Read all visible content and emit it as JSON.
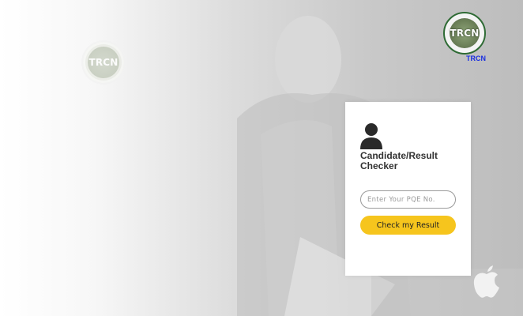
{
  "header": {
    "brand_text": "TRCN",
    "logo_text": "TRCN",
    "watermark_logo_text": "TRCN"
  },
  "login_card": {
    "title": "Candidate/Result Checker",
    "pqe_placeholder": "Enter Your PQE No.",
    "pqe_value": "",
    "submit_label": "Check my Result"
  },
  "colors": {
    "accent": "#f6c51d",
    "brand_text": "#1a2fe0",
    "logo_ring": "#2f6b35"
  },
  "icons": [
    "user-icon",
    "apple-logo-icon"
  ]
}
